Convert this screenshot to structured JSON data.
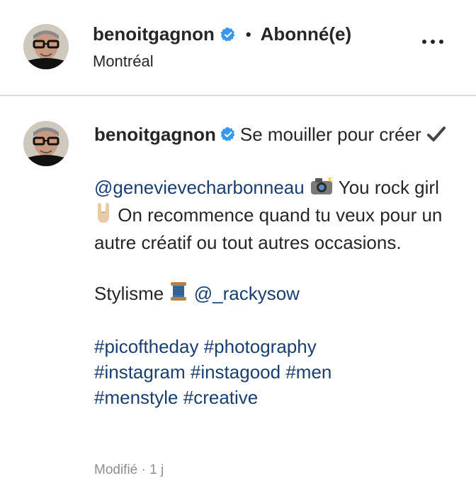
{
  "header": {
    "username": "benoitgagnon",
    "separator": "•",
    "follow_status": "Abonné(e)",
    "location": "Montréal",
    "more_icon": "more-horizontal-icon"
  },
  "caption": {
    "username": "benoitgagnon",
    "line1_text": "Se mouiller pour créer",
    "mention1": "@genevievecharbonneau",
    "text_after_mention1": "You rock girl",
    "text_after_rock": "On recommence quand tu veux pour un autre créatif ou tout autres occasions.",
    "styling_label": "Stylisme",
    "mention2": "@_rackysow",
    "hashtags": [
      "#picoftheday",
      "#photography",
      "#instagram",
      "#instagood",
      "#men",
      "#menstyle",
      "#creative"
    ]
  },
  "meta": {
    "edited_label": "Modifié",
    "separator": "·",
    "time_ago": "1 j"
  },
  "colors": {
    "text": "#262626",
    "link": "#1a3f6e",
    "verified": "#3897f0",
    "muted": "#8e8e8e",
    "divider": "#dbdbdb"
  }
}
